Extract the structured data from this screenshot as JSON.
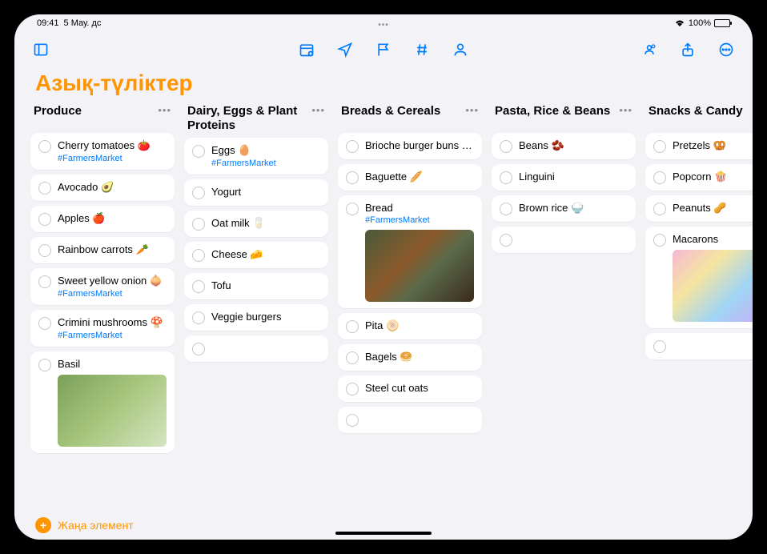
{
  "status": {
    "time": "09:41",
    "date": "5 Мау. дс",
    "battery": "100%"
  },
  "title": "Азық-түліктер",
  "footer": {
    "add_label": "Жаңа элемент"
  },
  "columns": [
    {
      "title": "Produce",
      "items": [
        {
          "label": "Cherry tomatoes 🍅",
          "tag": "#FarmersMarket"
        },
        {
          "label": "Avocado 🥑"
        },
        {
          "label": "Apples 🍎"
        },
        {
          "label": "Rainbow carrots 🥕"
        },
        {
          "label": "Sweet yellow onion 🧅",
          "tag": "#FarmersMarket"
        },
        {
          "label": "Crimini mushrooms 🍄",
          "tag": "#FarmersMarket"
        },
        {
          "label": "Basil",
          "image": "basil"
        }
      ]
    },
    {
      "title": "Dairy, Eggs & Plant Proteins",
      "items": [
        {
          "label": "Eggs 🥚",
          "tag": "#FarmersMarket"
        },
        {
          "label": "Yogurt"
        },
        {
          "label": "Oat milk 🥛"
        },
        {
          "label": "Cheese 🧀"
        },
        {
          "label": "Tofu"
        },
        {
          "label": "Veggie burgers"
        },
        {
          "empty": true
        }
      ]
    },
    {
      "title": "Breads & Cereals",
      "items": [
        {
          "label": "Brioche burger buns 🍔"
        },
        {
          "label": "Baguette 🥖"
        },
        {
          "label": "Bread",
          "tag": "#FarmersMarket",
          "image": "bread"
        },
        {
          "label": "Pita 🫓"
        },
        {
          "label": "Bagels 🥯"
        },
        {
          "label": "Steel cut oats"
        },
        {
          "empty": true
        }
      ]
    },
    {
      "title": "Pasta, Rice & Beans",
      "items": [
        {
          "label": "Beans 🫘"
        },
        {
          "label": "Linguini"
        },
        {
          "label": "Brown rice 🍚"
        },
        {
          "empty": true
        }
      ]
    },
    {
      "title": "Snacks & Candy",
      "items": [
        {
          "label": "Pretzels 🥨"
        },
        {
          "label": "Popcorn 🍿"
        },
        {
          "label": "Peanuts 🥜"
        },
        {
          "label": "Macarons",
          "image": "macaron"
        },
        {
          "empty": true
        }
      ]
    }
  ]
}
